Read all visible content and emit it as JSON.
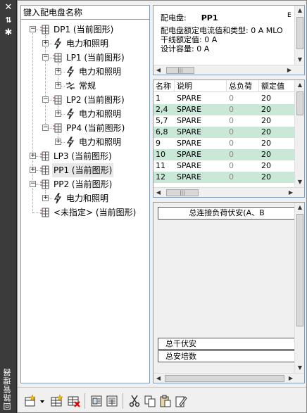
{
  "tree": {
    "header": "键入配电盘名称",
    "nodes": [
      {
        "label": "DP1 (当前图形)",
        "type": "panel",
        "expander": "−"
      },
      {
        "label": "电力和照明",
        "type": "circuit",
        "expander": "+"
      },
      {
        "label": "LP1 (当前图形)",
        "type": "panel",
        "expander": "−"
      },
      {
        "label": "电力和照明",
        "type": "circuit",
        "expander": "+"
      },
      {
        "label": "常规",
        "type": "general",
        "expander": "+"
      },
      {
        "label": "LP2 (当前图形)",
        "type": "panel",
        "expander": "−"
      },
      {
        "label": "电力和照明",
        "type": "circuit",
        "expander": "+"
      },
      {
        "label": "PP4 (当前图形)",
        "type": "panel",
        "expander": "−"
      },
      {
        "label": "电力和照明",
        "type": "circuit",
        "expander": "+"
      },
      {
        "label": "LP3 (当前图形)",
        "type": "panel",
        "expander": "+"
      },
      {
        "label": "PP1 (当前图形)",
        "type": "panel",
        "expander": "+"
      },
      {
        "label": "PP2 (当前图形)",
        "type": "panel",
        "expander": "−"
      },
      {
        "label": "电力和照明",
        "type": "circuit",
        "expander": "+"
      },
      {
        "label": "<未指定> (当前图形)",
        "type": "panel",
        "expander": ""
      }
    ]
  },
  "info": {
    "panel_label": "配电盘:",
    "panel_value": "PP1",
    "panel_extra": "E",
    "rating_line": "配电盘额定电流值和类型: 0 A MLO",
    "feeder_line": "干线额定值: 0 A",
    "design_line": "设计容量: 0 A"
  },
  "table": {
    "columns": [
      "名称",
      "说明",
      "总负荷",
      "额定值"
    ],
    "rows": [
      [
        "1",
        "SPARE",
        "0",
        "20"
      ],
      [
        "2,4",
        "SPARE",
        "0",
        "20"
      ],
      [
        "5,7",
        "SPARE",
        "0",
        "20"
      ],
      [
        "6,8",
        "SPARE",
        "0",
        "20"
      ],
      [
        "9",
        "SPARE",
        "0",
        "20"
      ],
      [
        "10",
        "SPARE",
        "0",
        "20"
      ],
      [
        "11",
        "SPARE",
        "0",
        "20"
      ],
      [
        "12",
        "SPARE",
        "0",
        "20"
      ]
    ]
  },
  "summary": {
    "header": "总连接负荷伏安(A、B",
    "total_kva": "总千伏安",
    "total_amps": "总安培数"
  },
  "palette": {
    "title": "回路管理器",
    "close_glyph": "✕",
    "autohide_glyph": "⇅",
    "props_glyph": "✱"
  },
  "colors": {
    "alt_row": "#c9e8d8",
    "strip_bg": "#3b3b3b",
    "tree_border": "#7f9db9"
  },
  "scroll_glyphs": {
    "left": "◀",
    "right": "▶",
    "up": "▲",
    "down": "▼",
    "grip": "|||"
  },
  "icons": [
    "new-panel-icon",
    "dropdown-arrow-icon",
    "new-circuit-icon",
    "delete-circuit-icon",
    "schedule-icon",
    "schedule-table-icon",
    "cut-icon",
    "copy-icon",
    "paste-icon",
    "edit-paste-icon"
  ]
}
